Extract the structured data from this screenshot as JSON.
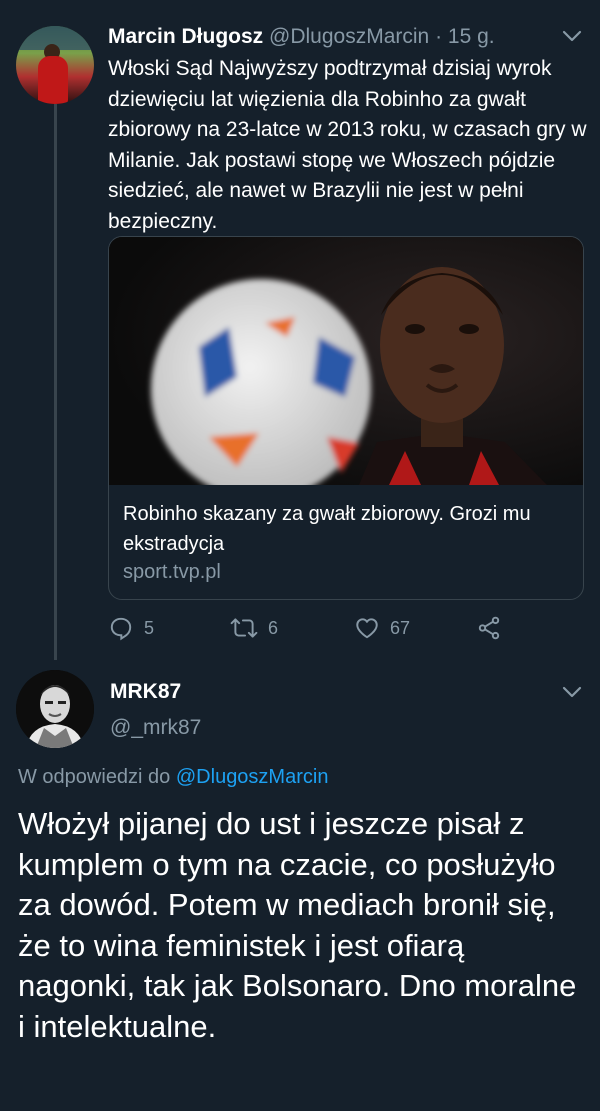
{
  "tweet": {
    "author_name": "Marcin Długosz",
    "author_handle": "@DlugoszMarcin",
    "separator": " · ",
    "time": "15 g.",
    "text": "Włoski Sąd Najwyższy podtrzymał dzisiaj wyrok dziewięciu lat więzienia dla Robinho za gwałt zbiorowy na 23-latce w 2013 roku, w czasach gry w Milanie. Jak postawi stopę we Włoszech pójdzie siedzieć, ale nawet w Brazylii nie jest w pełni bezpieczny.",
    "card": {
      "title": "Robinho skazany za gwałt zbiorowy. Grozi mu ekstradycja",
      "domain": "sport.tvp.pl"
    },
    "actions": {
      "replies": "5",
      "retweets": "6",
      "likes": "67"
    }
  },
  "reply": {
    "author_name": "MRK87",
    "author_handle": "@_mrk87",
    "replying_prefix": "W odpowiedzi do ",
    "replying_to": "@DlugoszMarcin",
    "text": "Włożył pijanej do ust i jeszcze pisał z kumplem o tym na czacie, co posłużyło za dowód. Potem w mediach bronił się, że to wina feministek i jest ofiarą nagonki, tak jak Bolsonaro. Dno moralne i intelektualne."
  },
  "colors": {
    "background": "#15202b",
    "text": "#ffffff",
    "muted": "#8899a6",
    "accent": "#1da1f2",
    "border": "#38444d"
  },
  "icons": [
    "reply-icon",
    "retweet-icon",
    "like-icon",
    "share-icon",
    "chevron-down-icon"
  ]
}
